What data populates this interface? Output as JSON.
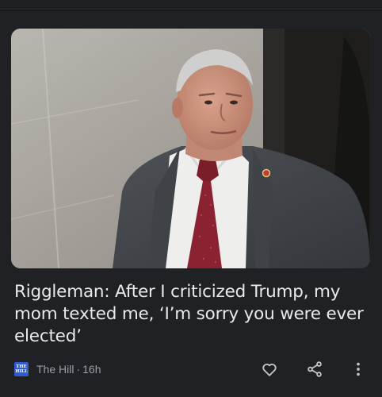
{
  "article": {
    "headline": "Riggleman: After I criticized Trump, my mom texted me, ‘I’m sorry you were ever elected’",
    "source": {
      "name": "The Hill",
      "logo_text": "THE HILL",
      "age": "16h",
      "separator": "·"
    },
    "image": {
      "subject": "man-in-grey-suit-red-tie-photo"
    },
    "actions": [
      {
        "name": "like",
        "icon": "heart-outline-icon"
      },
      {
        "name": "share",
        "icon": "share-icon"
      },
      {
        "name": "more",
        "icon": "more-vert-icon"
      }
    ]
  },
  "colors": {
    "background": "#202124",
    "headline_text": "#e8eaed",
    "meta_text": "#9aa0a6",
    "source_logo_bg": "#2f5bd0"
  }
}
